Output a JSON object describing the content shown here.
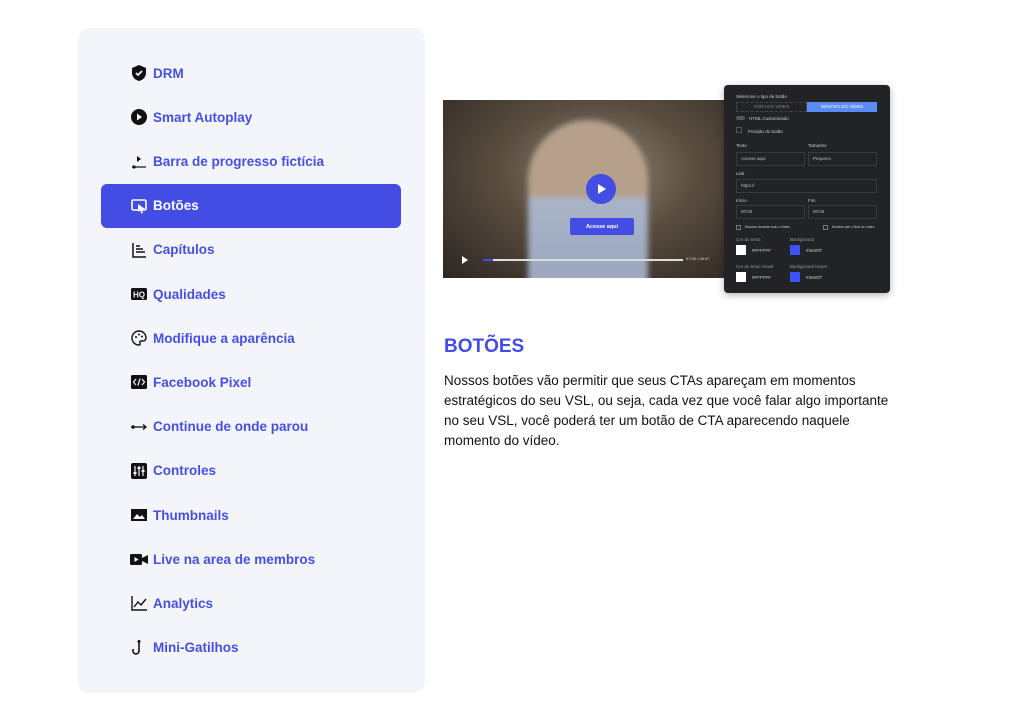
{
  "sidebar": {
    "items": [
      {
        "label": "DRM",
        "icon": "shield-check-icon"
      },
      {
        "label": "Smart Autoplay",
        "icon": "play-circle-icon"
      },
      {
        "label": "Barra de progresso fictícia",
        "icon": "progress-bar-icon"
      },
      {
        "label": "Botões",
        "icon": "cursor-click-icon",
        "active": true
      },
      {
        "label": "Capítulos",
        "icon": "chapters-icon"
      },
      {
        "label": "Qualidades",
        "icon": "hq-icon"
      },
      {
        "label": "Modifique a aparência",
        "icon": "palette-icon"
      },
      {
        "label": "Facebook Pixel",
        "icon": "code-icon"
      },
      {
        "label": "Continue de onde parou",
        "icon": "arrow-line-icon"
      },
      {
        "label": "Controles",
        "icon": "sliders-icon"
      },
      {
        "label": "Thumbnails",
        "icon": "image-icon"
      },
      {
        "label": "Live na area de membros",
        "icon": "video-camera-icon"
      },
      {
        "label": "Analytics",
        "icon": "chart-line-icon"
      },
      {
        "label": "Mini-Gatilhos",
        "icon": "hook-icon"
      }
    ]
  },
  "video": {
    "cta_label": "Acesse aqui",
    "time": "07:00 / 08:47"
  },
  "panel": {
    "title": "Selecione o tipo de botão",
    "tab1": "FORA DO VÍDEO",
    "tab2": "DENTRO DO VÍDEO",
    "toggle": "HTML Customizado",
    "position": "Posição do botão",
    "text_label": "Texto",
    "text_value": "Acesse aqui",
    "size_label": "Tamanho",
    "size_value": "Pequeno",
    "link_label": "Link",
    "link_value": "https://",
    "start_label": "Início",
    "start_value": "00:00",
    "end_label": "Fim",
    "end_value": "00:05",
    "check1": "Mostrar durante todo o vídeo",
    "check2": "Mostrar até o final do vídeo",
    "color_label": "Cor do texto",
    "color_value": "#FFFFFF",
    "bg_label": "Background",
    "bg_value": "#3e50f7",
    "hover_color_label": "Cor do texto Hover",
    "hover_color_value": "#FFFFFF",
    "hover_bg_label": "Background Hover",
    "hover_bg_value": "#3e50f7"
  },
  "content": {
    "title": "BOTÕES",
    "description": "Nossos botões vão permitir que seus CTAs apareçam em momentos estratégicos do seu VSL, ou seja, cada vez que você falar algo importante no seu VSL, você poderá ter um botão de CTA aparecendo naquele momento do vídeo."
  },
  "colors": {
    "accent": "#434de3",
    "sidebar_bg": "#f4f5fb"
  }
}
